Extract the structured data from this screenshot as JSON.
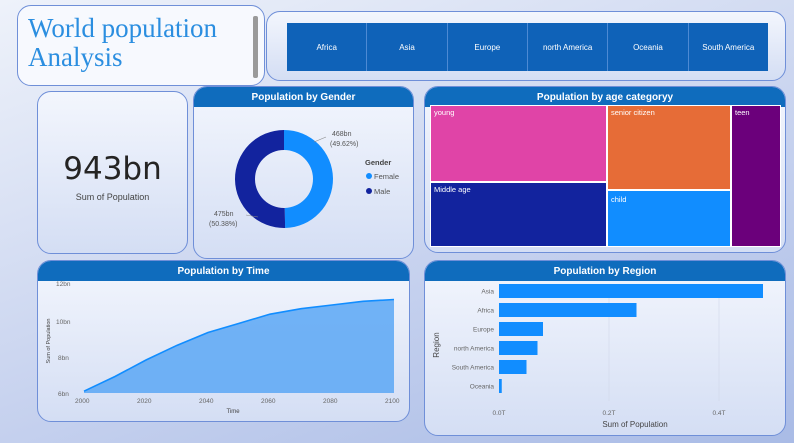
{
  "header": {
    "title": "World population Analysis"
  },
  "slicer": {
    "items": [
      "Africa",
      "Asia",
      "Europe",
      "north America",
      "Oceania",
      "South America"
    ]
  },
  "kpi": {
    "value": "943bn",
    "label": "Sum of Population"
  },
  "gender": {
    "title": "Population by Gender",
    "legend_title": "Gender",
    "female_label": "468bn",
    "female_pct": "(49.62%)",
    "male_label": "475bn",
    "male_pct": "(50.38%)"
  },
  "age": {
    "title": "Population by age categoryy",
    "tiles": [
      "young",
      "senior citizen",
      "teen",
      "Middle age",
      "child"
    ]
  },
  "time_chart": {
    "title": "Population by Time",
    "xlabel": "Time",
    "ylabel": "Sum of Population",
    "y_ticks": [
      "12bn",
      "10bn",
      "8bn",
      "6bn"
    ],
    "x_ticks": [
      "2000",
      "2020",
      "2040",
      "2060",
      "2080",
      "2100"
    ]
  },
  "region_chart": {
    "title": "Population by Region",
    "xlabel": "Sum of Population",
    "ylabel": "Region",
    "x_ticks": [
      "0.0T",
      "0.2T",
      "0.4T"
    ]
  },
  "colors": {
    "accent": "#0f6cbd",
    "female": "#118dff",
    "male": "#12239e",
    "young": "#e044a7",
    "senior": "#e66c37",
    "teen": "#6b007b",
    "middle": "#12239e",
    "child": "#118dff"
  },
  "chart_data": [
    {
      "type": "pie",
      "title": "Population by Gender",
      "categories": [
        "Female",
        "Male"
      ],
      "values": [
        468,
        475
      ],
      "unit": "bn"
    },
    {
      "type": "heatmap",
      "title": "Population by age categoryy",
      "categories": [
        "young",
        "senior citizen",
        "teen",
        "Middle age",
        "child"
      ]
    },
    {
      "type": "area",
      "title": "Population by Time",
      "xlabel": "Time",
      "ylabel": "Sum of Population",
      "x": [
        2000,
        2010,
        2020,
        2030,
        2040,
        2050,
        2060,
        2070,
        2080,
        2090,
        2100
      ],
      "values": [
        6.1,
        6.9,
        7.8,
        8.6,
        9.3,
        9.8,
        10.3,
        10.6,
        10.8,
        11.0,
        11.1
      ],
      "ylim": [
        6,
        12
      ],
      "xlim": [
        2000,
        2100
      ],
      "unit": "bn"
    },
    {
      "type": "bar",
      "title": "Population by Region",
      "xlabel": "Sum of Population",
      "ylabel": "Region",
      "categories": [
        "Asia",
        "Africa",
        "Europe",
        "north America",
        "South America",
        "Oceania"
      ],
      "values": [
        0.48,
        0.25,
        0.08,
        0.07,
        0.05,
        0.005
      ],
      "xlim": [
        0,
        0.5
      ],
      "unit": "T"
    }
  ]
}
